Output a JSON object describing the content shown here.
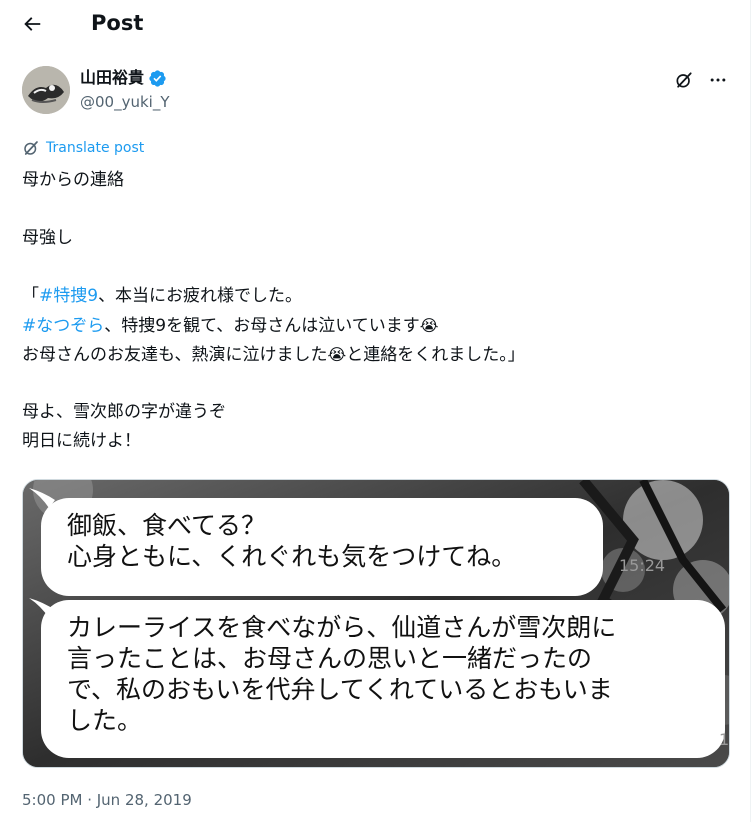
{
  "header": {
    "title": "Post",
    "back_icon": "arrow-left-icon"
  },
  "author": {
    "name": "山田裕貴",
    "handle": "@00_yuki_Y",
    "verified_color": "#1d9bf0"
  },
  "actions": {
    "grok_icon": "grok-icon",
    "more_icon": "more-horizontal-icon"
  },
  "translate": {
    "label": "Translate post",
    "color": "#1d9bf0"
  },
  "post": {
    "lines": [
      {
        "text": "母からの連絡"
      },
      {
        "blank": true
      },
      {
        "text": "母強し"
      },
      {
        "blank": true
      },
      {
        "p1": "「",
        "tag1": "#特捜9",
        "p2": "、本当にお疲れ様でした。"
      },
      {
        "tag2": "#なつぞら",
        "p3": "、特捜9を観て、お母さんは泣いています",
        "e1": "😭"
      },
      {
        "p4": "お母さんのお友達も、熱演に泣けました",
        "e2": "😭",
        "p5": "と連絡をくれました。」"
      },
      {
        "blank": true
      },
      {
        "text": "母よ、雪次郎の字が違うぞ"
      },
      {
        "text": "明日に続けよ！"
      }
    ]
  },
  "media": {
    "bubble1": [
      "御飯、食べてる？",
      "心身ともに、くれぐれも気をつけてね。"
    ],
    "bubble2": [
      "カレーライスを食べながら、仙道さんが雪次朗に",
      "言ったことは、お母さんの思いと一緒だったの",
      "で、私のおもいを代弁してくれているとおもいま",
      "した。"
    ],
    "time": "15:24",
    "page_marker": "1"
  },
  "timestamp": "5:00 PM · Jun 28, 2019"
}
